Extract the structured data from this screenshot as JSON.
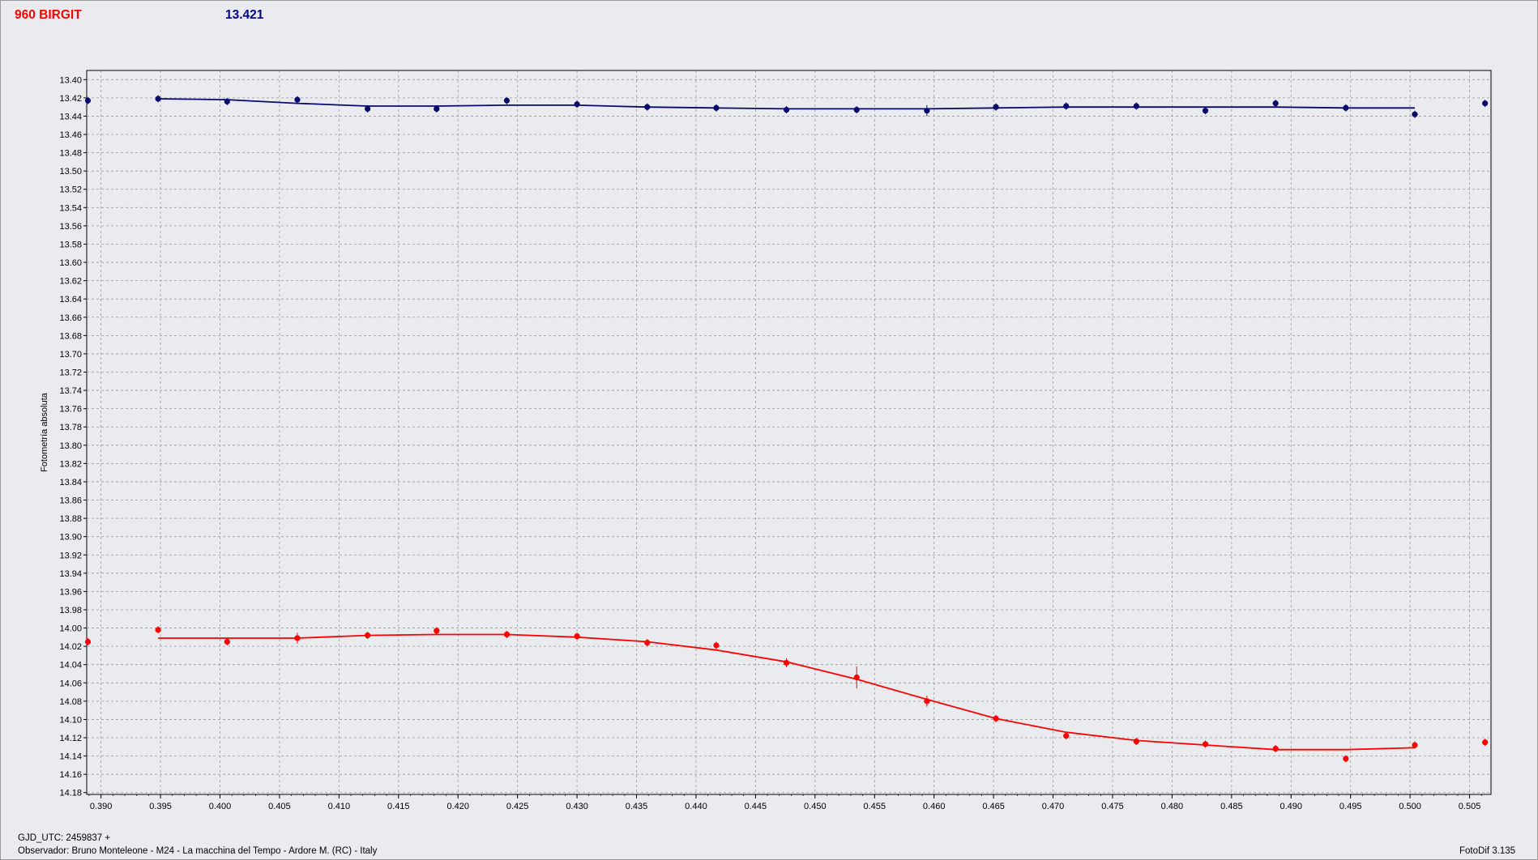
{
  "header": {
    "star_name": "960 BIRGIT",
    "current_mag": "13.421"
  },
  "footer": {
    "gjd": "GJD_UTC: 2459837 +",
    "observer": "Observador: Bruno Monteleone - M24 - La macchina del Tempo - Ardore M. (RC) - Italy",
    "version": "FotoDif 3.135"
  },
  "colors": {
    "star_series": "#ff0000",
    "comparison_series": "#0a0a6e",
    "grid": "#9a9a9a",
    "plot_background": "#e9ebee"
  },
  "chart_data": {
    "type": "scatter",
    "title": "",
    "xlabel": "",
    "ylabel": "Fotometría absoluta",
    "xlim": [
      0.3888,
      0.5068
    ],
    "ylim": [
      13.39,
      14.182
    ],
    "y_inverted": true,
    "grid": true,
    "x_ticks": [
      "0.390",
      "0.395",
      "0.400",
      "0.405",
      "0.410",
      "0.415",
      "0.420",
      "0.425",
      "0.430",
      "0.435",
      "0.440",
      "0.445",
      "0.450",
      "0.455",
      "0.460",
      "0.465",
      "0.470",
      "0.475",
      "0.480",
      "0.485",
      "0.490",
      "0.495",
      "0.500",
      "0.505"
    ],
    "y_ticks": [
      "13.40",
      "13.42",
      "13.44",
      "13.46",
      "13.48",
      "13.50",
      "13.52",
      "13.54",
      "13.56",
      "13.58",
      "13.60",
      "13.62",
      "13.64",
      "13.66",
      "13.68",
      "13.70",
      "13.72",
      "13.74",
      "13.76",
      "13.78",
      "13.80",
      "13.82",
      "13.84",
      "13.86",
      "13.88",
      "13.90",
      "13.92",
      "13.94",
      "13.96",
      "13.98",
      "14.00",
      "14.02",
      "14.04",
      "14.06",
      "14.08",
      "14.10",
      "14.12",
      "14.14",
      "14.16",
      "14.18"
    ],
    "series": [
      {
        "color": "#0a0a6e",
        "points": [
          {
            "x": 0.3889,
            "y": 13.423,
            "err": 0.004
          },
          {
            "x": 0.3948,
            "y": 13.421,
            "err": 0.004
          },
          {
            "x": 0.4006,
            "y": 13.424,
            "err": 0.004
          },
          {
            "x": 0.4065,
            "y": 13.422,
            "err": 0.004
          },
          {
            "x": 0.4124,
            "y": 13.432,
            "err": 0.004
          },
          {
            "x": 0.4182,
            "y": 13.432,
            "err": 0.004
          },
          {
            "x": 0.4241,
            "y": 13.423,
            "err": 0.004
          },
          {
            "x": 0.43,
            "y": 13.427,
            "err": 0.004
          },
          {
            "x": 0.4359,
            "y": 13.43,
            "err": 0.004
          },
          {
            "x": 0.4417,
            "y": 13.431,
            "err": 0.004
          },
          {
            "x": 0.4476,
            "y": 13.433,
            "err": 0.004
          },
          {
            "x": 0.4535,
            "y": 13.433,
            "err": 0.004
          },
          {
            "x": 0.4594,
            "y": 13.434,
            "err": 0.006
          },
          {
            "x": 0.4652,
            "y": 13.43,
            "err": 0.004
          },
          {
            "x": 0.4711,
            "y": 13.429,
            "err": 0.004
          },
          {
            "x": 0.477,
            "y": 13.429,
            "err": 0.004
          },
          {
            "x": 0.4828,
            "y": 13.434,
            "err": 0.004
          },
          {
            "x": 0.4887,
            "y": 13.426,
            "err": 0.004
          },
          {
            "x": 0.4946,
            "y": 13.431,
            "err": 0.004
          },
          {
            "x": 0.5004,
            "y": 13.438,
            "err": 0.004
          },
          {
            "x": 0.5063,
            "y": 13.426,
            "err": 0.004
          }
        ],
        "fit": [
          {
            "x": 0.3948,
            "y": 13.421
          },
          {
            "x": 0.4006,
            "y": 13.422
          },
          {
            "x": 0.4065,
            "y": 13.426
          },
          {
            "x": 0.4124,
            "y": 13.429
          },
          {
            "x": 0.4182,
            "y": 13.429
          },
          {
            "x": 0.4241,
            "y": 13.428
          },
          {
            "x": 0.43,
            "y": 13.428
          },
          {
            "x": 0.4359,
            "y": 13.43
          },
          {
            "x": 0.4417,
            "y": 13.431
          },
          {
            "x": 0.4476,
            "y": 13.432
          },
          {
            "x": 0.4535,
            "y": 13.432
          },
          {
            "x": 0.4594,
            "y": 13.432
          },
          {
            "x": 0.4652,
            "y": 13.431
          },
          {
            "x": 0.4711,
            "y": 13.43
          },
          {
            "x": 0.477,
            "y": 13.43
          },
          {
            "x": 0.4828,
            "y": 13.43
          },
          {
            "x": 0.4887,
            "y": 13.43
          },
          {
            "x": 0.4946,
            "y": 13.431
          },
          {
            "x": 0.5004,
            "y": 13.431
          }
        ]
      },
      {
        "color": "#ff0000",
        "points": [
          {
            "x": 0.3889,
            "y": 14.015,
            "err": 0.004
          },
          {
            "x": 0.3948,
            "y": 14.002,
            "err": 0.004
          },
          {
            "x": 0.4006,
            "y": 14.015,
            "err": 0.004
          },
          {
            "x": 0.4065,
            "y": 14.011,
            "err": 0.006
          },
          {
            "x": 0.4124,
            "y": 14.008,
            "err": 0.004
          },
          {
            "x": 0.4182,
            "y": 14.003,
            "err": 0.004
          },
          {
            "x": 0.4241,
            "y": 14.007,
            "err": 0.004
          },
          {
            "x": 0.43,
            "y": 14.009,
            "err": 0.004
          },
          {
            "x": 0.4359,
            "y": 14.016,
            "err": 0.004
          },
          {
            "x": 0.4417,
            "y": 14.019,
            "err": 0.004
          },
          {
            "x": 0.4476,
            "y": 14.038,
            "err": 0.005
          },
          {
            "x": 0.4535,
            "y": 14.054,
            "err": 0.012
          },
          {
            "x": 0.4594,
            "y": 14.08,
            "err": 0.006
          },
          {
            "x": 0.4652,
            "y": 14.099,
            "err": 0.004
          },
          {
            "x": 0.4711,
            "y": 14.118,
            "err": 0.004
          },
          {
            "x": 0.477,
            "y": 14.124,
            "err": 0.004
          },
          {
            "x": 0.4828,
            "y": 14.127,
            "err": 0.004
          },
          {
            "x": 0.4887,
            "y": 14.132,
            "err": 0.004
          },
          {
            "x": 0.4946,
            "y": 14.143,
            "err": 0.004
          },
          {
            "x": 0.5004,
            "y": 14.128,
            "err": 0.004
          },
          {
            "x": 0.5063,
            "y": 14.125,
            "err": 0.004
          }
        ],
        "fit": [
          {
            "x": 0.3948,
            "y": 14.011
          },
          {
            "x": 0.4006,
            "y": 14.011
          },
          {
            "x": 0.4065,
            "y": 14.011
          },
          {
            "x": 0.4124,
            "y": 14.008
          },
          {
            "x": 0.4182,
            "y": 14.007
          },
          {
            "x": 0.4241,
            "y": 14.007
          },
          {
            "x": 0.43,
            "y": 14.01
          },
          {
            "x": 0.4359,
            "y": 14.015
          },
          {
            "x": 0.4417,
            "y": 14.024
          },
          {
            "x": 0.4476,
            "y": 14.037
          },
          {
            "x": 0.4535,
            "y": 14.056
          },
          {
            "x": 0.4594,
            "y": 14.078
          },
          {
            "x": 0.4652,
            "y": 14.099
          },
          {
            "x": 0.4711,
            "y": 14.114
          },
          {
            "x": 0.477,
            "y": 14.123
          },
          {
            "x": 0.4828,
            "y": 14.128
          },
          {
            "x": 0.4887,
            "y": 14.133
          },
          {
            "x": 0.4946,
            "y": 14.133
          },
          {
            "x": 0.5004,
            "y": 14.131
          }
        ]
      }
    ]
  }
}
